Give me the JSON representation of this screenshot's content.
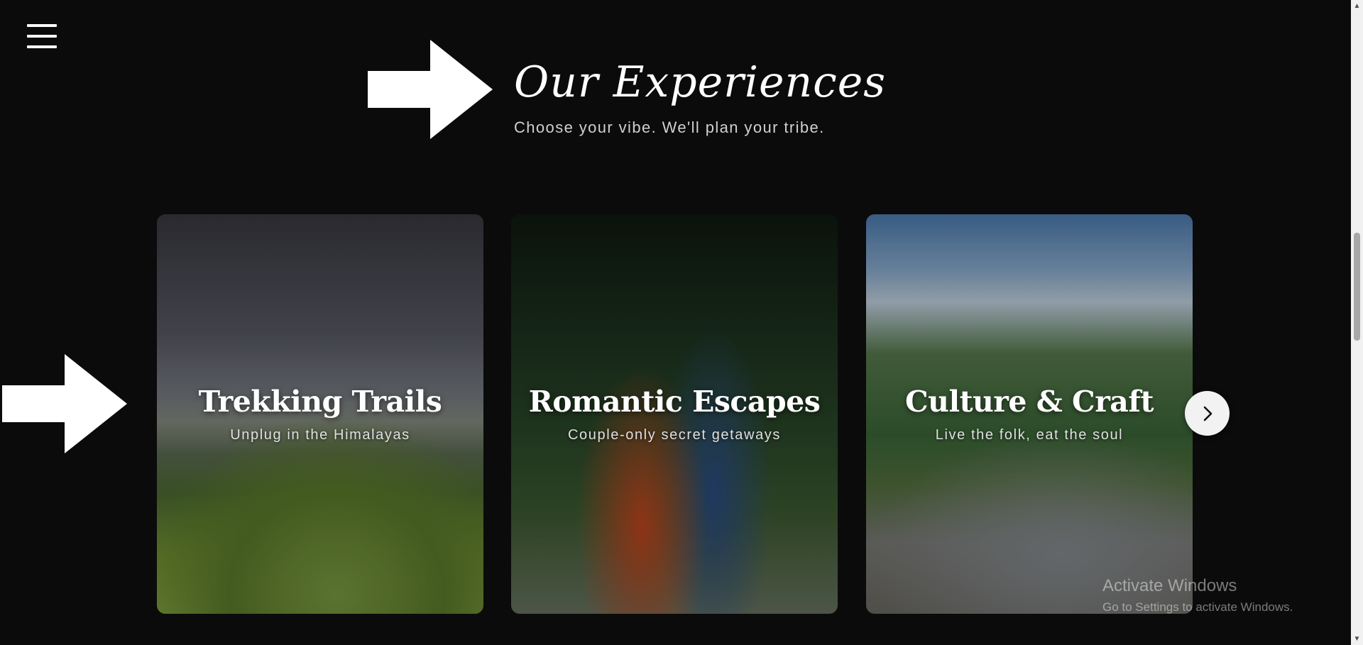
{
  "header": {
    "menu_icon": "hamburger-icon",
    "title": "Our Experiences",
    "subtitle": "Choose your vibe. We'll plan your tribe."
  },
  "cards": [
    {
      "title": "Trekking Trails",
      "subtitle": "Unplug in the Himalayas"
    },
    {
      "title": "Romantic Escapes",
      "subtitle": "Couple-only secret getaways"
    },
    {
      "title": "Culture & Craft",
      "subtitle": "Live the folk, eat the soul"
    }
  ],
  "carousel": {
    "next_icon": "chevron-right-icon"
  },
  "annotations": {
    "arrow_icon": "arrow-right-icon",
    "arrow_color": "#ffffff"
  },
  "watermark": {
    "line1": "Activate Windows",
    "line2": "Go to Settings to activate Windows."
  },
  "colors": {
    "background": "#0b0b0c",
    "text": "#ffffff",
    "subtitle": "#d0d0d0"
  }
}
